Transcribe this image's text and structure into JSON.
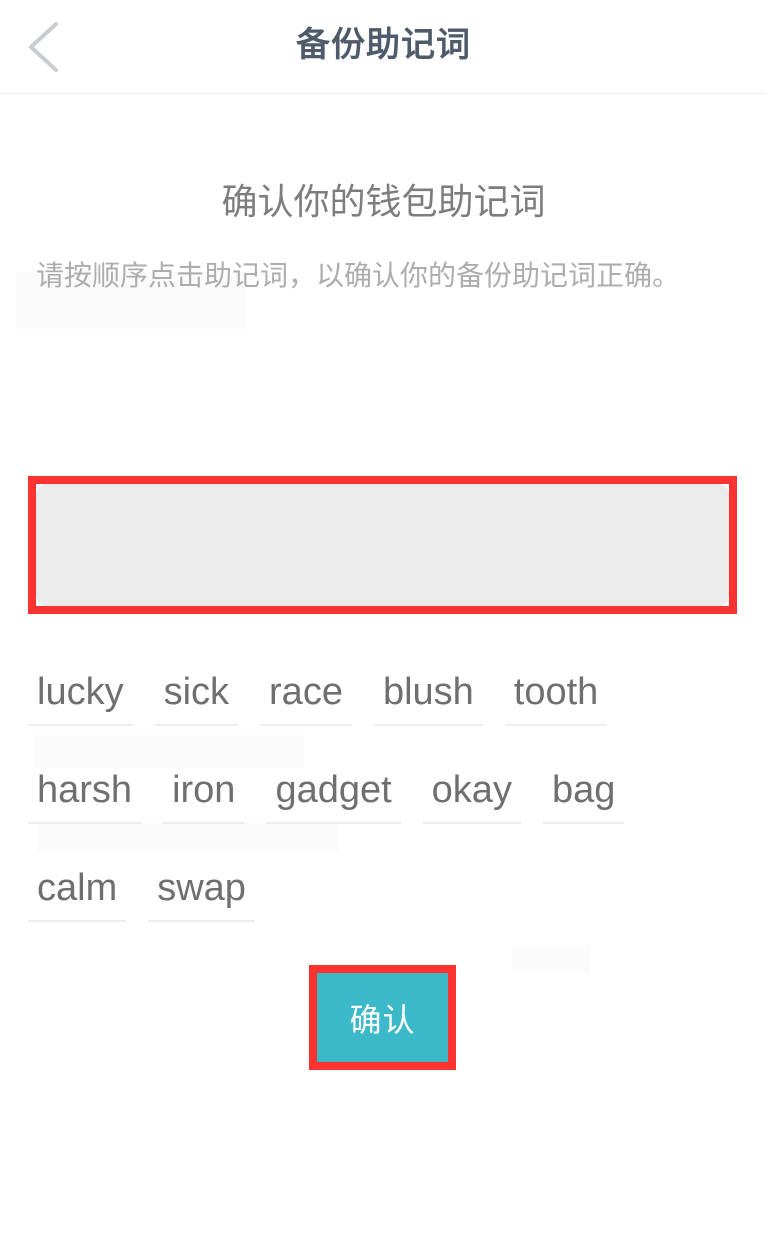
{
  "header": {
    "title": "备份助记词",
    "back_icon": "chevron-left-icon"
  },
  "main": {
    "section_title": "确认你的钱包助记词",
    "section_description": "请按顺序点击助记词，以确认你的备份助记词正确。",
    "answer_area": {
      "selected_words": [],
      "placeholder": ""
    },
    "word_bank": {
      "words": [
        "lucky",
        "sick",
        "race",
        "blush",
        "tooth",
        "harsh",
        "iron",
        "gadget",
        "okay",
        "bag",
        "calm",
        "swap"
      ]
    },
    "confirm_button": {
      "label": "确认"
    }
  },
  "colors": {
    "header_title": "#4f5b6b",
    "section_title": "#7d7d7d",
    "section_description": "#adadad",
    "word_text": "#6f6f6f",
    "answer_box_fill": "#ebebeb",
    "confirm_button_bg": "#3bb9c9",
    "confirm_button_text": "#ffffff",
    "highlight_border": "#fb3330",
    "page_background": "#ffffff"
  }
}
